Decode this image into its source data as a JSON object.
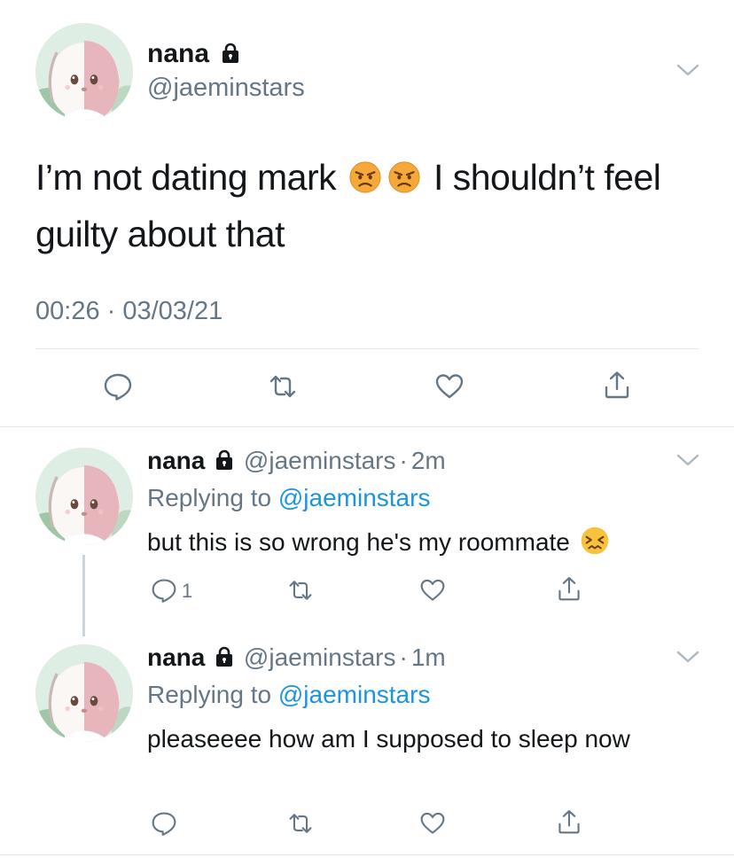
{
  "main_tweet": {
    "name": "nana",
    "handle": "@jaeminstars",
    "text_part1": "I’m not dating mark",
    "text_part2": "I shouldn’t feel guilty about that",
    "emojis": [
      "angry-face-emoji",
      "angry-face-emoji"
    ],
    "timestamp": "00:26 · 03/03/21"
  },
  "replies": [
    {
      "name": "nana",
      "handle": "@jaeminstars",
      "time_sep": "·",
      "time": "2m",
      "replying_prefix": "Replying to",
      "replying_to": "@jaeminstars",
      "text": "but this is so wrong he's my roommate",
      "emoji": "confounded-face-emoji",
      "reply_count": "1"
    },
    {
      "name": "nana",
      "handle": "@jaeminstars",
      "time_sep": "·",
      "time": "1m",
      "replying_prefix": "Replying to",
      "replying_to": "@jaeminstars",
      "text": "pleaseeee how am I supposed to sleep now",
      "reply_count": ""
    }
  ],
  "icons": {
    "reply": "reply-icon",
    "retweet": "retweet-icon",
    "like": "heart-icon",
    "share": "share-icon",
    "lock": "lock-icon",
    "more": "chevron-down-icon"
  },
  "colors": {
    "text": "#14171a",
    "secondary": "#657786",
    "link": "#1b95e0",
    "divider": "#e1e8ed"
  }
}
